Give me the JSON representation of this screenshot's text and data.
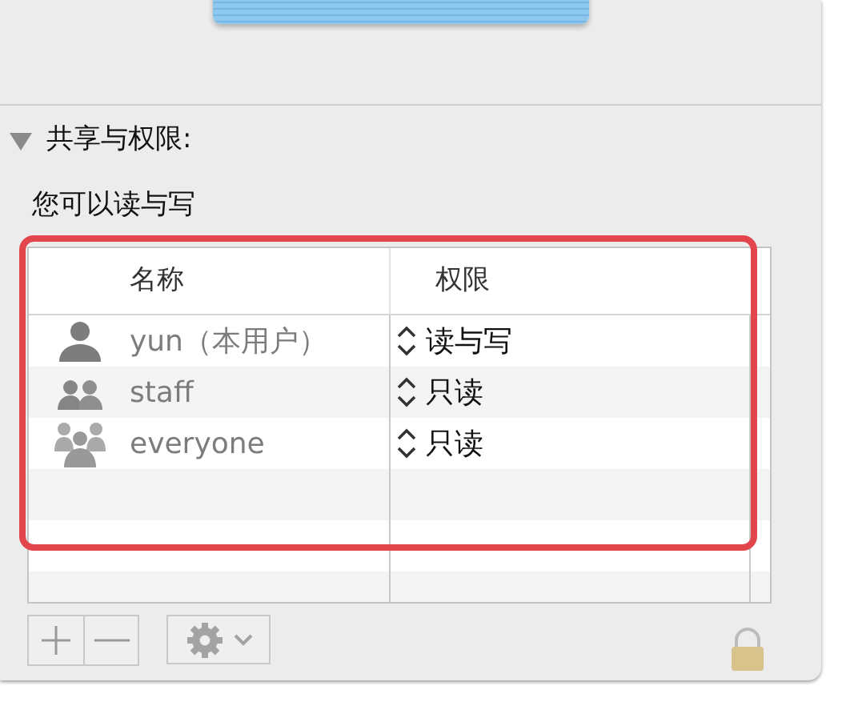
{
  "sharing": {
    "title": "共享与权限:",
    "expanded": true,
    "summary": "您可以读与写",
    "table": {
      "columns": [
        "名称",
        "权限"
      ],
      "rows": [
        {
          "kind": "user",
          "name": "yun（本用户）",
          "permission": "读与写"
        },
        {
          "kind": "group",
          "name": "staff",
          "permission": "只读"
        },
        {
          "kind": "everyone",
          "name": "everyone",
          "permission": "只读"
        }
      ]
    }
  }
}
